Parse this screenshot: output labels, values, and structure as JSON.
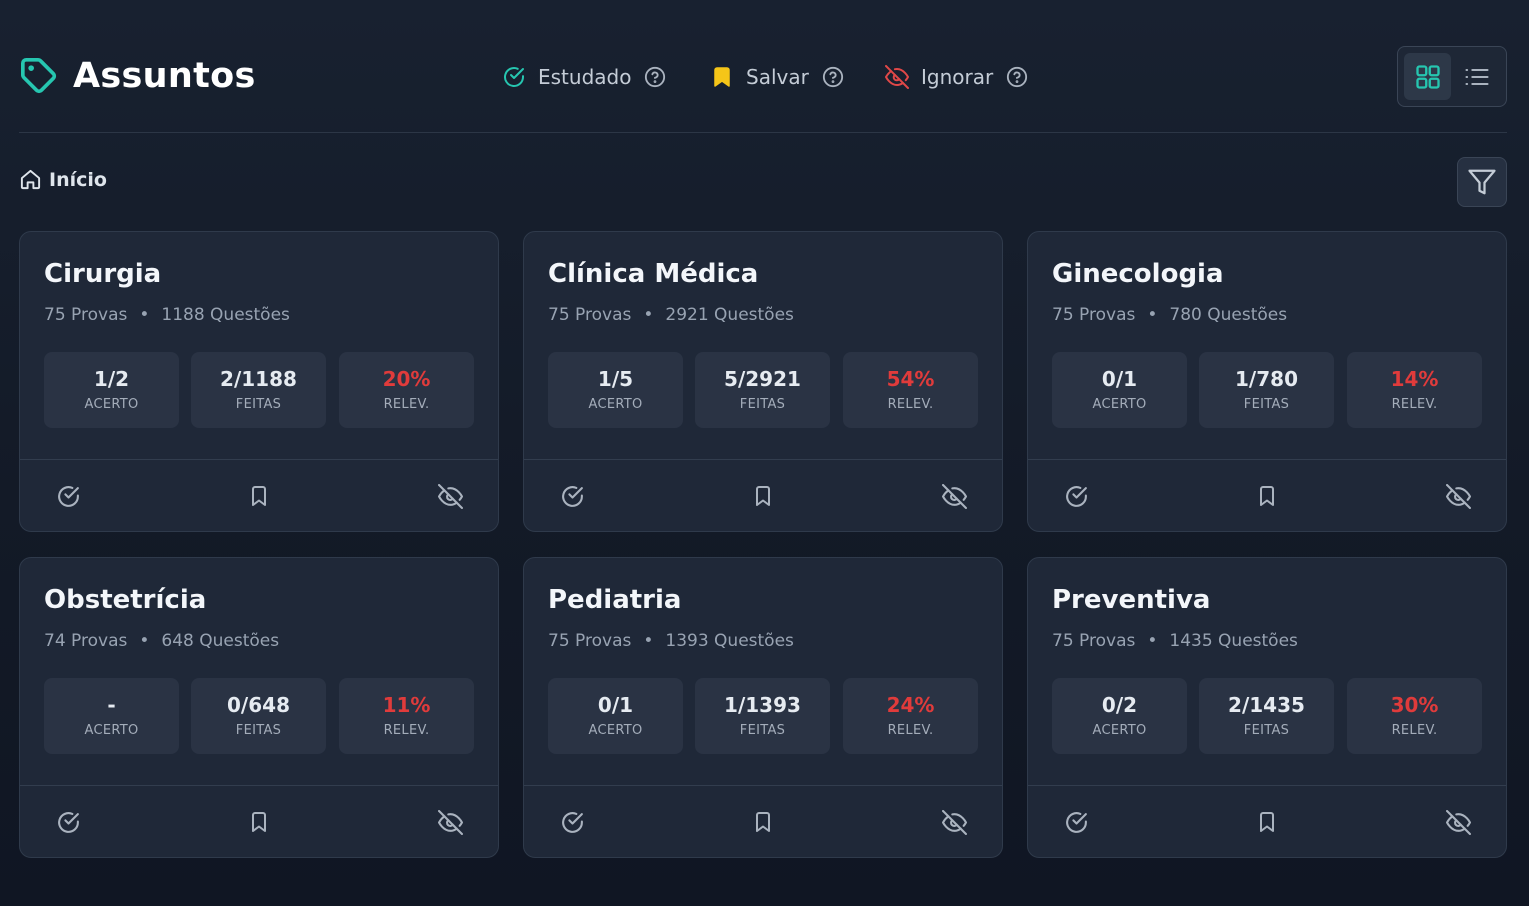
{
  "header": {
    "title": "Assuntos",
    "legend": [
      {
        "label": "Estudado",
        "icon": "check-circle-icon",
        "color": "#26c6b0"
      },
      {
        "label": "Salvar",
        "icon": "bookmark-icon",
        "color": "#f5c518"
      },
      {
        "label": "Ignorar",
        "icon": "eye-off-icon",
        "color": "#e04848"
      }
    ],
    "view_mode": "grid"
  },
  "breadcrumb": {
    "label": "Início"
  },
  "colors": {
    "accent": "#26c6b0",
    "relevance": "#e03b3b",
    "save": "#f5c518"
  },
  "cards": [
    {
      "title": "Cirurgia",
      "provas": "75 Provas",
      "questoes": "1188 Questões",
      "acerto": "1/2",
      "acerto_label": "ACERTO",
      "feitas": "2/1188",
      "feitas_label": "FEITAS",
      "relev": "20%",
      "relev_label": "RELEV."
    },
    {
      "title": "Clínica Médica",
      "provas": "75 Provas",
      "questoes": "2921 Questões",
      "acerto": "1/5",
      "acerto_label": "ACERTO",
      "feitas": "5/2921",
      "feitas_label": "FEITAS",
      "relev": "54%",
      "relev_label": "RELEV."
    },
    {
      "title": "Ginecologia",
      "provas": "75 Provas",
      "questoes": "780 Questões",
      "acerto": "0/1",
      "acerto_label": "ACERTO",
      "feitas": "1/780",
      "feitas_label": "FEITAS",
      "relev": "14%",
      "relev_label": "RELEV."
    },
    {
      "title": "Obstetrícia",
      "provas": "74 Provas",
      "questoes": "648 Questões",
      "acerto": "-",
      "acerto_label": "ACERTO",
      "feitas": "0/648",
      "feitas_label": "FEITAS",
      "relev": "11%",
      "relev_label": "RELEV."
    },
    {
      "title": "Pediatria",
      "provas": "75 Provas",
      "questoes": "1393 Questões",
      "acerto": "0/1",
      "acerto_label": "ACERTO",
      "feitas": "1/1393",
      "feitas_label": "FEITAS",
      "relev": "24%",
      "relev_label": "RELEV."
    },
    {
      "title": "Preventiva",
      "provas": "75 Provas",
      "questoes": "1435 Questões",
      "acerto": "0/2",
      "acerto_label": "ACERTO",
      "feitas": "2/1435",
      "feitas_label": "FEITAS",
      "relev": "30%",
      "relev_label": "RELEV."
    }
  ]
}
